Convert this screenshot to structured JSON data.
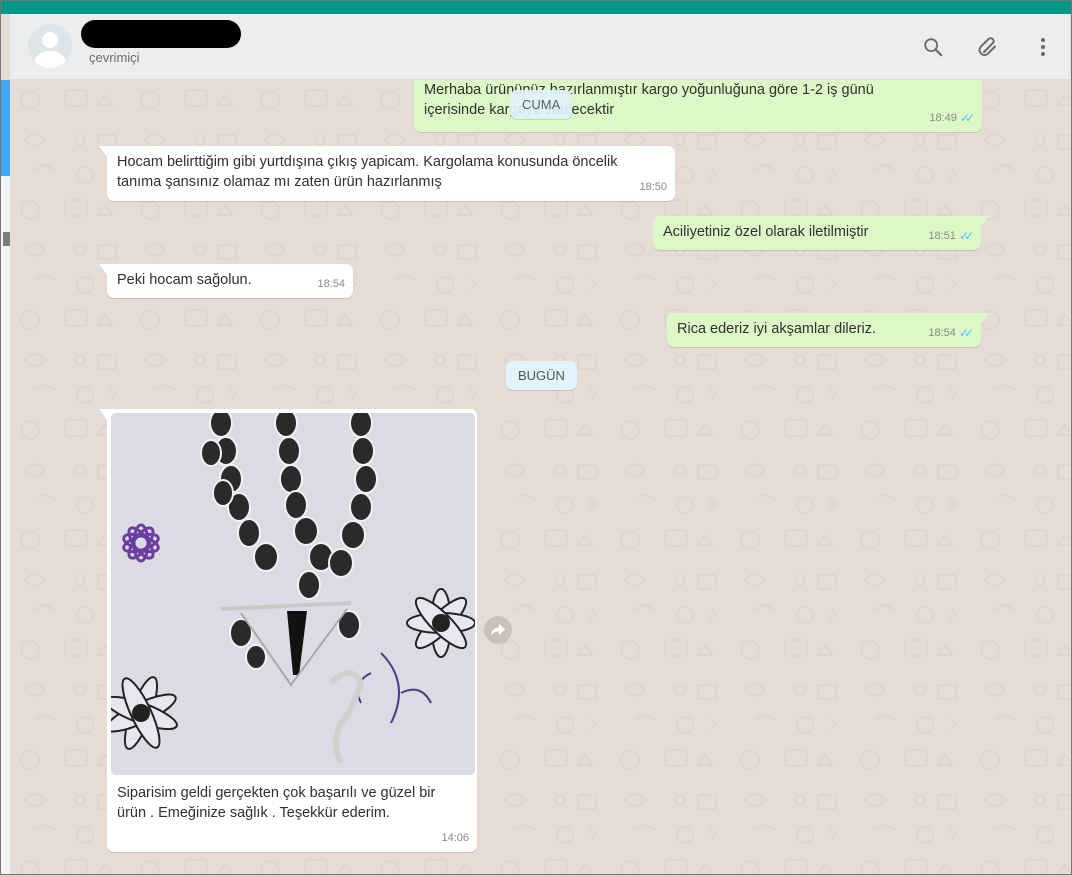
{
  "header": {
    "contact_name": "",
    "status": "çevrimiçi",
    "icons": [
      "search-icon",
      "attach-icon",
      "menu-icon"
    ]
  },
  "colors": {
    "accent": "#009688",
    "incoming": "#ffffff",
    "outgoing": "#dcf8c6",
    "ticks": "#4fc3f7",
    "chat_bg": "#e5ddd5"
  },
  "messages": [
    {
      "dir": "out",
      "text_line1": "Merhaba ürününüz hazırlanmıştır kargo yoğunluğuna göre 1-2 iş günü",
      "text_line2": "içerisinde kargoya verilecektir",
      "time": "18:49",
      "ticks": "✓✓"
    },
    {
      "dir": "in",
      "text_line1": "Hocam belirttiğim gibi yurtdışına çıkış yapicam. Kargolama konusunda öncelik",
      "text_line2": "tanıma şansınız olamaz mı zaten ürün hazırlanmış",
      "time": "18:50"
    },
    {
      "dir": "out",
      "text": "Aciliyetiniz özel olarak iletilmiştir",
      "time": "18:51",
      "ticks": "✓✓"
    },
    {
      "dir": "in",
      "text": "Peki hocam sağolun.",
      "time": "18:54"
    },
    {
      "dir": "out",
      "text": "Rica ederiz iyi akşamlar dileriz.",
      "time": "18:54",
      "ticks": "✓✓"
    },
    {
      "dir": "in",
      "type": "image",
      "caption_line1": "Siparisim geldi gerçekten çok başarılı ve güzel bir",
      "caption_line2": "ürün . Emeğinize sağlık . Teşekkür ederim.",
      "time": "14:06"
    }
  ],
  "day_chips": {
    "first": "CUMA",
    "second": "BUGÜN"
  }
}
